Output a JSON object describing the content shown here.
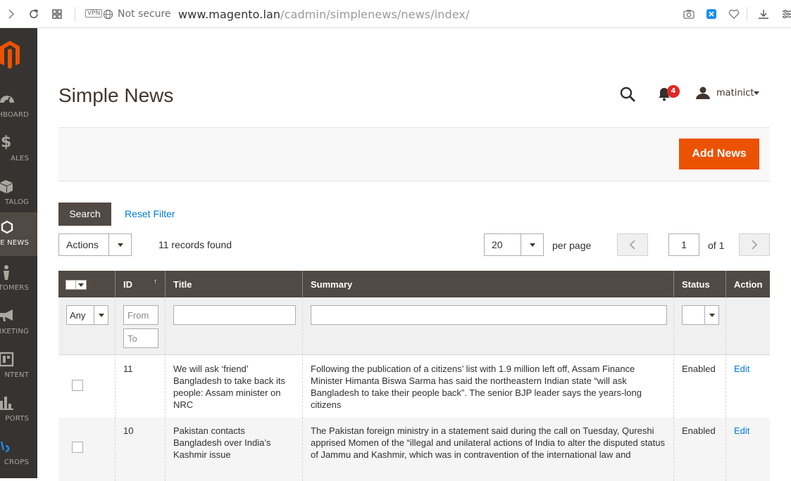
{
  "browser": {
    "vpn": "VPN",
    "security": "Not secure",
    "url_host": "www.magento.lan",
    "url_path": "/cadmin/simplenews/news/index/"
  },
  "sidebar": {
    "items": [
      {
        "label": "HBOARD",
        "icon": "dashboard-icon"
      },
      {
        "label": "ALES",
        "icon": "dollar-icon"
      },
      {
        "label": "TALOG",
        "icon": "box-icon"
      },
      {
        "label": "LE NEWS",
        "icon": "hexagon-icon"
      },
      {
        "label": "TOMERS",
        "icon": "person-icon"
      },
      {
        "label": "RKETING",
        "icon": "megaphone-icon"
      },
      {
        "label": "NTENT",
        "icon": "layout-icon"
      },
      {
        "label": "PORTS",
        "icon": "bar-chart-icon"
      },
      {
        "label": "CROPS",
        "icon": "crop-icon"
      }
    ]
  },
  "header": {
    "title": "Simple News",
    "notifications": "4",
    "user": "matinict"
  },
  "actions": {
    "add_label": "Add News"
  },
  "search": {
    "search_label": "Search",
    "reset_label": "Reset Filter"
  },
  "toolbar": {
    "actions_label": "Actions",
    "records": "11 records found",
    "per_page": "20",
    "per_page_label": "per page",
    "page": "1",
    "page_of": "of 1"
  },
  "grid": {
    "columns": [
      "ID",
      "Title",
      "Summary",
      "Status",
      "Action"
    ],
    "filters": {
      "any": "Any",
      "from": "From",
      "to": "To"
    },
    "rows": [
      {
        "id": "11",
        "title": "We will ask ‘friend’ Bangladesh to take back its people: Assam minister on NRC",
        "summary": "Following the publication of a citizens’ list with 1.9 million left off, Assam Finance Minister Himanta Biswa Sarma has said the northeastern Indian state “will ask Bangladesh to take their people back”. The senior BJP leader says the years-long citizens",
        "status": "Enabled",
        "action": "Edit"
      },
      {
        "id": "10",
        "title": "Pakistan contacts Bangladesh over India’s Kashmir issue",
        "summary": "The Pakistan foreign ministry in a statement said during the call on Tuesday, Qureshi apprised Momen of the “illegal and unilateral actions of India to alter the disputed status of Jammu and Kashmir, which was in contravention of the international law and",
        "status": "Enabled",
        "action": "Edit"
      }
    ]
  }
}
